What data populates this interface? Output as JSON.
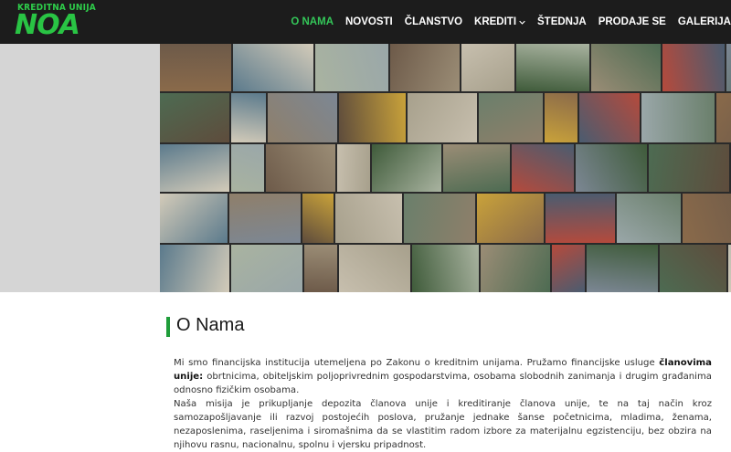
{
  "brand": {
    "top_text": "KREDITNA UNIJA",
    "name": "NOA",
    "color": "#2ecc4a"
  },
  "nav": {
    "items": [
      {
        "label": "O NAMA",
        "active": true
      },
      {
        "label": "NOVOSTI",
        "active": false
      },
      {
        "label": "ČLANSTVO",
        "active": false
      },
      {
        "label": "KREDITI",
        "active": false,
        "dropdown": true
      },
      {
        "label": "ŠTEDNJA",
        "active": false
      },
      {
        "label": "PRODAJE SE",
        "active": false
      },
      {
        "label": "GALERIJA",
        "active": false
      }
    ],
    "active_color": "#34c759"
  },
  "hero": {
    "icon": "photo-collage-image"
  },
  "main": {
    "title": "O Nama",
    "accent": "#1f9d3a",
    "p1_pre": "Mi smo financijska institucija utemeljena po Zakonu o kreditnim unijama. Pružamo financijske usluge ",
    "p1_strong": "članovima unije:",
    "p1_post": " obrtnicima, obiteljskim poljoprivrednim gospodarstvima, osobama slobodnih zanimanja i drugim građanima odnosno fizičkim osobama.",
    "p2": "Naša misija je prikupljanje depozita članova unije i kreditiranje članova unije, te na taj način kroz samozapošljavanje ili razvoj postojećih poslova, pružanje jednake šanse početnicima, mladima, ženama, nezaposlenima, raseljenima i siromašnima da se vlastitim radom izbore za materijalnu egzistenciju, bez obzira na njihovu rasnu, nacionalnu, spolnu i vjersku pripadnost."
  }
}
